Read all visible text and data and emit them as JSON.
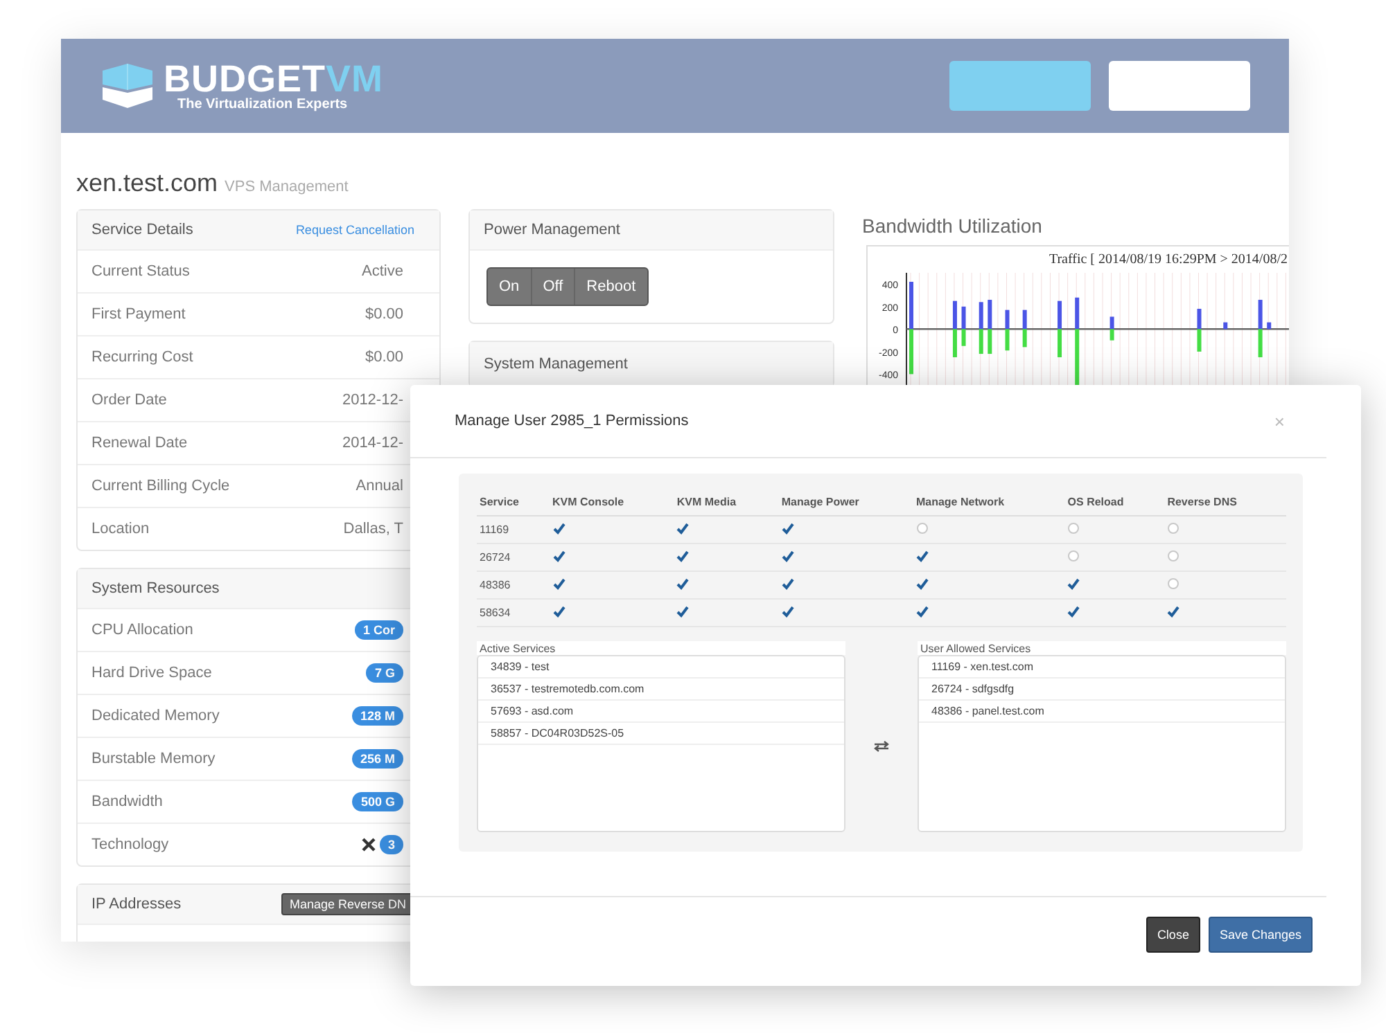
{
  "header": {
    "logo": {
      "brand": "BUDGET",
      "brand_accent": "VM",
      "tagline": "The Virtualization Experts"
    },
    "buttons": [
      {
        "kind": "accent"
      },
      {
        "kind": "plain"
      }
    ]
  },
  "page": {
    "title": "xen.test.com",
    "subtitle": "VPS Management"
  },
  "service_details": {
    "title": "Service Details",
    "action": "Request Cancellation",
    "rows": [
      {
        "label": "Current Status",
        "value": "Active"
      },
      {
        "label": "First Payment",
        "value": "$0.00"
      },
      {
        "label": "Recurring Cost",
        "value": "$0.00"
      },
      {
        "label": "Order Date",
        "value": "2012-12-"
      },
      {
        "label": "Renewal Date",
        "value": "2014-12-"
      },
      {
        "label": "Current Billing Cycle",
        "value": "Annual"
      },
      {
        "label": "Location",
        "value": "Dallas, T"
      }
    ]
  },
  "system_resources": {
    "title": "System Resources",
    "rows": [
      {
        "label": "CPU Allocation",
        "badge": "1 Cor",
        "kind": "badge"
      },
      {
        "label": "Hard Drive Space",
        "badge": "7 G",
        "kind": "badge"
      },
      {
        "label": "Dedicated Memory",
        "badge": "128 M",
        "kind": "badge"
      },
      {
        "label": "Burstable Memory",
        "badge": "256 M",
        "kind": "badge"
      },
      {
        "label": "Bandwidth",
        "badge": "500 G",
        "kind": "badge"
      },
      {
        "label": "Technology",
        "badge": "3",
        "kind": "logo-badge"
      }
    ]
  },
  "ip_addresses": {
    "title": "IP Addresses",
    "action": "Manage Reverse DN"
  },
  "power_management": {
    "title": "Power Management",
    "buttons": [
      "On",
      "Off",
      "Reboot"
    ]
  },
  "system_management": {
    "title": "System Management"
  },
  "bandwidth": {
    "title": "Bandwidth Utilization",
    "chart_data": {
      "type": "bar",
      "title": "Traffic [ 2014/08/19 16:29PM > 2014/08/2",
      "yticks": [
        400,
        200,
        0,
        -200,
        -400
      ],
      "ylim": [
        -533,
        500
      ],
      "grid": true,
      "series": [
        {
          "color": "#4b55e6",
          "values": [
            420,
            0,
            0,
            0,
            0,
            250,
            200,
            0,
            240,
            260,
            0,
            170,
            0,
            170,
            0,
            0,
            0,
            250,
            0,
            280,
            0,
            0,
            0,
            110,
            0,
            0,
            0,
            0,
            0,
            0,
            0,
            0,
            0,
            180,
            0,
            0,
            60,
            0,
            0,
            0,
            260,
            60,
            0,
            0
          ]
        },
        {
          "color": "#44dd44",
          "values": [
            -400,
            0,
            0,
            0,
            0,
            -250,
            -150,
            0,
            -220,
            -220,
            0,
            -190,
            0,
            -160,
            0,
            0,
            0,
            -250,
            0,
            -520,
            0,
            0,
            0,
            -100,
            0,
            0,
            0,
            0,
            0,
            0,
            0,
            0,
            0,
            -200,
            0,
            0,
            0,
            0,
            0,
            0,
            -250,
            0,
            0,
            0
          ]
        }
      ]
    }
  },
  "modal": {
    "title": "Manage User 2985_1 Permissions",
    "close": "×",
    "permissions": {
      "columns": [
        "Service",
        "KVM Console",
        "KVM Media",
        "Manage Power",
        "Manage Network",
        "OS Reload",
        "Reverse DNS"
      ],
      "rows": [
        {
          "service": "11169",
          "perms": [
            true,
            true,
            true,
            false,
            false,
            false
          ]
        },
        {
          "service": "26724",
          "perms": [
            true,
            true,
            true,
            true,
            false,
            false
          ]
        },
        {
          "service": "48386",
          "perms": [
            true,
            true,
            true,
            true,
            true,
            false
          ]
        },
        {
          "service": "58634",
          "perms": [
            true,
            true,
            true,
            true,
            true,
            true
          ]
        }
      ]
    },
    "active_services": {
      "label": "Active Services",
      "items": [
        "34839 - test",
        "36537 - testremotedb.com.com",
        "57693 - asd.com",
        "58857 - DC04R03D52S-05"
      ]
    },
    "allowed_services": {
      "label": "User Allowed Services",
      "items": [
        "11169 - xen.test.com",
        "26724 - sdfgsdfg",
        "48386 - panel.test.com"
      ]
    },
    "buttons": [
      {
        "label": "Close",
        "kind": "secondary"
      },
      {
        "label": "Save Changes",
        "kind": "primary"
      }
    ]
  }
}
